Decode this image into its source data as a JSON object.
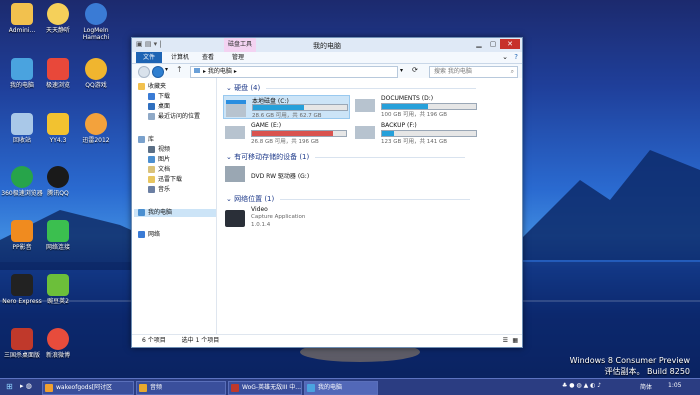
{
  "desktop": {
    "icons": [
      {
        "label": "Admini...",
        "color": "#f2c14e"
      },
      {
        "label": "天天静听",
        "color": "#f5d05a"
      },
      {
        "label": "LogMeIn Hamachi",
        "color": "#3a7bd5"
      },
      {
        "label": "我的电脑",
        "color": "#4aa3df"
      },
      {
        "label": "极速浏览",
        "color": "#e8483a"
      },
      {
        "label": "QQ游戏",
        "color": "#f0b52f"
      },
      {
        "label": "回收站",
        "color": "#a9c8e8"
      },
      {
        "label": "YY4.3",
        "color": "#f2c230"
      },
      {
        "label": "迅雷2012",
        "color": "#f3a23c"
      },
      {
        "label": "360极速浏览器",
        "color": "#27a44a"
      },
      {
        "label": "腾讯QQ",
        "color": "#1a1a1a"
      },
      {
        "label": "PP影音",
        "color": "#f08b1f"
      },
      {
        "label": "网络连接",
        "color": "#3bbf4f"
      },
      {
        "label": "Nero Express",
        "color": "#222222"
      },
      {
        "label": "豌豆荚2",
        "color": "#6cbf3a"
      },
      {
        "label": "三国杀桌面版",
        "color": "#c0392b"
      },
      {
        "label": "新浪微博",
        "color": "#e74c3c"
      }
    ],
    "watermark_line1": "Windows 8 Consumer Preview",
    "watermark_line2": "评估副本。 Build 8250"
  },
  "window": {
    "title": "我的电脑",
    "context_tab": "磁盘工具",
    "ribbon_tabs": [
      "文件",
      "计算机",
      "查看",
      "管理"
    ],
    "address": "我的电脑",
    "search_placeholder": "搜索 我的电脑",
    "nav": {
      "favorites": "收藏夹",
      "fav_items": [
        "下载",
        "桌面",
        "最近访问的位置"
      ],
      "libraries": "库",
      "lib_items": [
        "视频",
        "图片",
        "文档",
        "迅雷下载",
        "音乐"
      ],
      "computer": "我的电脑",
      "network": "网络"
    },
    "groups": {
      "hard_drives": "硬盘 (4)",
      "removable": "有可移动存储的设备 (1)",
      "network": "网络位置 (1)"
    },
    "drives": [
      {
        "name": "本地磁盘 (C:)",
        "info": "28.6 GB 可用，共 62.7 GB",
        "used": 0.54
      },
      {
        "name": "DOCUMENTS (D:)",
        "info": "100 GB 可用，共 196 GB",
        "used": 0.49
      },
      {
        "name": "GAME (E:)",
        "info": "26.8 GB 可用，共 196 GB",
        "used": 0.86
      },
      {
        "name": "BACKUP (F:)",
        "info": "123 GB 可用，共 141 GB",
        "used": 0.13
      }
    ],
    "dvd": {
      "name": "DVD RW 驱动器 (G:)"
    },
    "netloc": {
      "name": "Video",
      "desc": "Capture Application",
      "version": "1.0.1.4"
    },
    "status": {
      "count": "6 个项目",
      "selected": "选中 1 个项目"
    }
  },
  "taskbar": {
    "buttons": [
      {
        "label": "wakeofgods[阿讨区",
        "color": "#f0a030"
      },
      {
        "label": "音频",
        "color": "#e8a92f"
      },
      {
        "label": "WoG-英雄无敌III 中...",
        "color": "#c0392b"
      },
      {
        "label": "我的电脑",
        "color": "#4aa3df"
      }
    ],
    "lang": "简体",
    "time": "1:05"
  },
  "colors": {
    "accent": "#26a0da",
    "ribbon_file": "#1e64b4",
    "taskbar": "#2b3d82"
  }
}
